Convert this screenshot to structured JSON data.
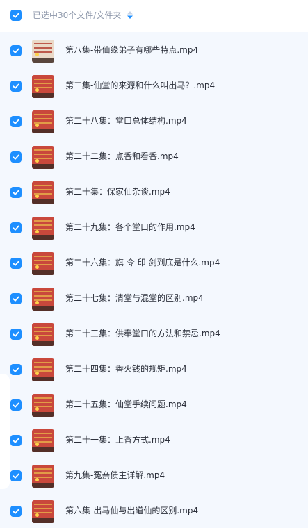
{
  "header": {
    "title": "已选中30个文件/文件夹",
    "sort_icon": "sort-icon",
    "checkbox_icon": "check-icon"
  },
  "accent_color": "#1e8fff",
  "files": [
    {
      "name": "第八集-带仙缘弟子有哪些特点.mp4",
      "thumb": "light"
    },
    {
      "name": "第二集-仙堂的来源和什么叫出马？.mp4",
      "thumb": "red"
    },
    {
      "name": "第二十八集：堂口总体结构.mp4",
      "thumb": "red"
    },
    {
      "name": "第二十二集：点香和看香.mp4",
      "thumb": "red"
    },
    {
      "name": "第二十集：保家仙杂谈.mp4",
      "thumb": "red"
    },
    {
      "name": "第二十九集：各个堂口的作用.mp4",
      "thumb": "red"
    },
    {
      "name": "第二十六集：旗 令 印 剑到底是什么.mp4",
      "thumb": "red"
    },
    {
      "name": "第二十七集：清堂与混堂的区别.mp4",
      "thumb": "red"
    },
    {
      "name": "第二十三集：供奉堂口的方法和禁忌.mp4",
      "thumb": "red"
    },
    {
      "name": "第二十四集：香火钱的规矩.mp4",
      "thumb": "red"
    },
    {
      "name": "第二十五集：仙堂手续问题.mp4",
      "thumb": "red"
    },
    {
      "name": "第二十一集：上香方式.mp4",
      "thumb": "red"
    },
    {
      "name": "第九集-冤亲债主详解.mp4",
      "thumb": "red"
    },
    {
      "name": "第六集-出马仙与出道仙的区别.mp4",
      "thumb": "red"
    }
  ]
}
